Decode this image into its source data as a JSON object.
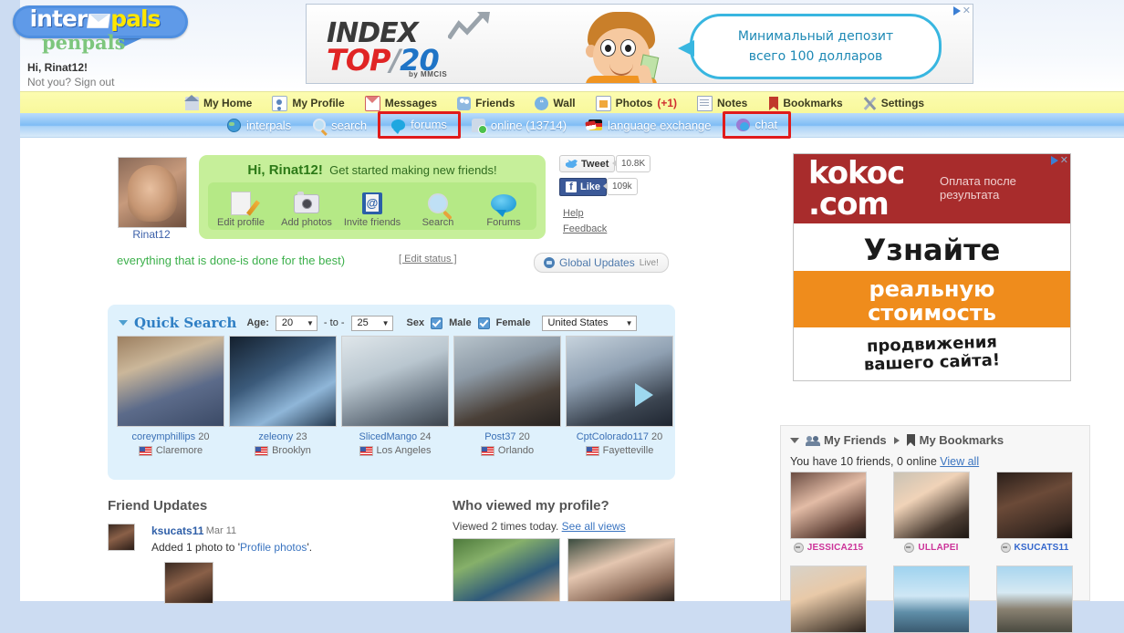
{
  "header": {
    "logo": {
      "part1": "inter",
      "part2": "pals",
      "sub": "penpals",
      "envelope_icon": "envelope-icon"
    },
    "greeting": "Hi, Rinat12!",
    "not_you": "Not you?",
    "sign_out": "Sign out"
  },
  "top_ad": {
    "brand": "INDEX",
    "top": "TOP",
    "slash": "/",
    "twenty": "20",
    "by": "by  MMCIS",
    "bubble_line1": "Минимальный депозит",
    "bubble_line2": "всего 100 долларов",
    "close_icon": "close-icon",
    "adchoices_icon": "adchoices-icon"
  },
  "nav_top": [
    {
      "label": "My Home",
      "icon": "home-icon"
    },
    {
      "label": "My Profile",
      "icon": "profile-icon"
    },
    {
      "label": "Messages",
      "icon": "mail-icon"
    },
    {
      "label": "Friends",
      "icon": "friends-icon"
    },
    {
      "label": "Wall",
      "icon": "wall-icon"
    },
    {
      "label": "Photos",
      "badge": "(+1)",
      "icon": "photos-icon"
    },
    {
      "label": "Notes",
      "icon": "notes-icon"
    },
    {
      "label": "Bookmarks",
      "icon": "bookmark-icon"
    },
    {
      "label": "Settings",
      "icon": "settings-icon"
    }
  ],
  "nav_sub": [
    {
      "label": "interpals",
      "icon": "globe-icon",
      "highlighted": false
    },
    {
      "label": "search",
      "icon": "search-icon",
      "highlighted": false
    },
    {
      "label": "forums",
      "icon": "forums-icon",
      "highlighted": true
    },
    {
      "label": "online (13714)",
      "icon": "online-icon",
      "highlighted": false
    },
    {
      "label": "language exchange",
      "icon": "flags-icon",
      "highlighted": false
    },
    {
      "label": "chat",
      "icon": "chat-icon",
      "highlighted": true
    }
  ],
  "profile": {
    "name": "Rinat12",
    "avatar": "user-avatar",
    "welcome_title": "Hi, Rinat12!",
    "welcome_sub": "Get started making new friends!",
    "actions": [
      {
        "label": "Edit profile",
        "icon": "edit-profile-icon"
      },
      {
        "label": "Add photos",
        "icon": "camera-icon"
      },
      {
        "label": "Invite friends",
        "icon": "address-book-icon"
      },
      {
        "label": "Search",
        "icon": "magnifier-icon"
      },
      {
        "label": "Forums",
        "icon": "speech-bubble-icon"
      }
    ],
    "status": "everything that is done-is done for the best)",
    "edit_status": "[ Edit status ]"
  },
  "social": {
    "tweet_label": "Tweet",
    "tweet_count": "10.8K",
    "like_label": "Like",
    "like_count": "109k",
    "help": "Help",
    "feedback": "Feedback",
    "global_updates": "Global Updates",
    "global_updates_live": "Live!"
  },
  "quick_search": {
    "title": "Quick Search",
    "age_label": "Age:",
    "age_from": "20",
    "to_label": "- to -",
    "age_to": "25",
    "sex_label": "Sex",
    "male_label": "Male",
    "male_checked": true,
    "female_label": "Female",
    "female_checked": true,
    "country": "United States",
    "next_icon": "next-arrow-icon",
    "results": [
      {
        "name": "coreymphillips",
        "age": "20",
        "location": "Claremore",
        "thumb": "t1"
      },
      {
        "name": "zeleony",
        "age": "23",
        "location": "Brooklyn",
        "thumb": "t2"
      },
      {
        "name": "SlicedMango",
        "age": "24",
        "location": "Los Angeles",
        "thumb": "t3"
      },
      {
        "name": "Post37",
        "age": "20",
        "location": "Orlando",
        "thumb": "t4"
      },
      {
        "name": "CptColorado117",
        "age": "20",
        "location": "Fayetteville",
        "thumb": "t5"
      }
    ]
  },
  "friend_updates": {
    "title": "Friend Updates",
    "item": {
      "user": "ksucats11",
      "date": "- Mar 11",
      "text_before": "Added 1 photo to '",
      "link": "Profile photos",
      "text_after": "'."
    }
  },
  "who_viewed": {
    "title": "Who viewed my profile?",
    "subtitle": "Viewed 2 times today.",
    "see_all": "See all views"
  },
  "friends_panel": {
    "tab_friends": "My Friends",
    "tab_bookmarks": "My Bookmarks",
    "stat": "You have 10 friends, 0 online",
    "view_all": "View all",
    "friends": [
      {
        "name": "JESSICA215",
        "color": "#cc3399",
        "thumb": "fr-a"
      },
      {
        "name": "ULLAPEI",
        "color": "#cc3399",
        "thumb": "fr-b"
      },
      {
        "name": "KSUCATS11",
        "color": "#3366cc",
        "thumb": "fr-c"
      },
      {
        "name": "",
        "color": "#3366cc",
        "thumb": "fr-d"
      },
      {
        "name": "",
        "color": "#3366cc",
        "thumb": "fr-e"
      },
      {
        "name": "",
        "color": "#3366cc",
        "thumb": "fr-f"
      }
    ]
  },
  "side_ad": {
    "logo_line1": "kokoc",
    "logo_line2": ".com",
    "sub_line1": "Оплата после",
    "sub_line2": "результата",
    "white_text": "Узнайте",
    "orange_line1": "реальную",
    "orange_line2": "стоимость",
    "bottom_line1": "продвижения",
    "bottom_line2": "вашего сайта!",
    "close_icon": "close-icon",
    "adchoices_icon": "adchoices-icon"
  }
}
